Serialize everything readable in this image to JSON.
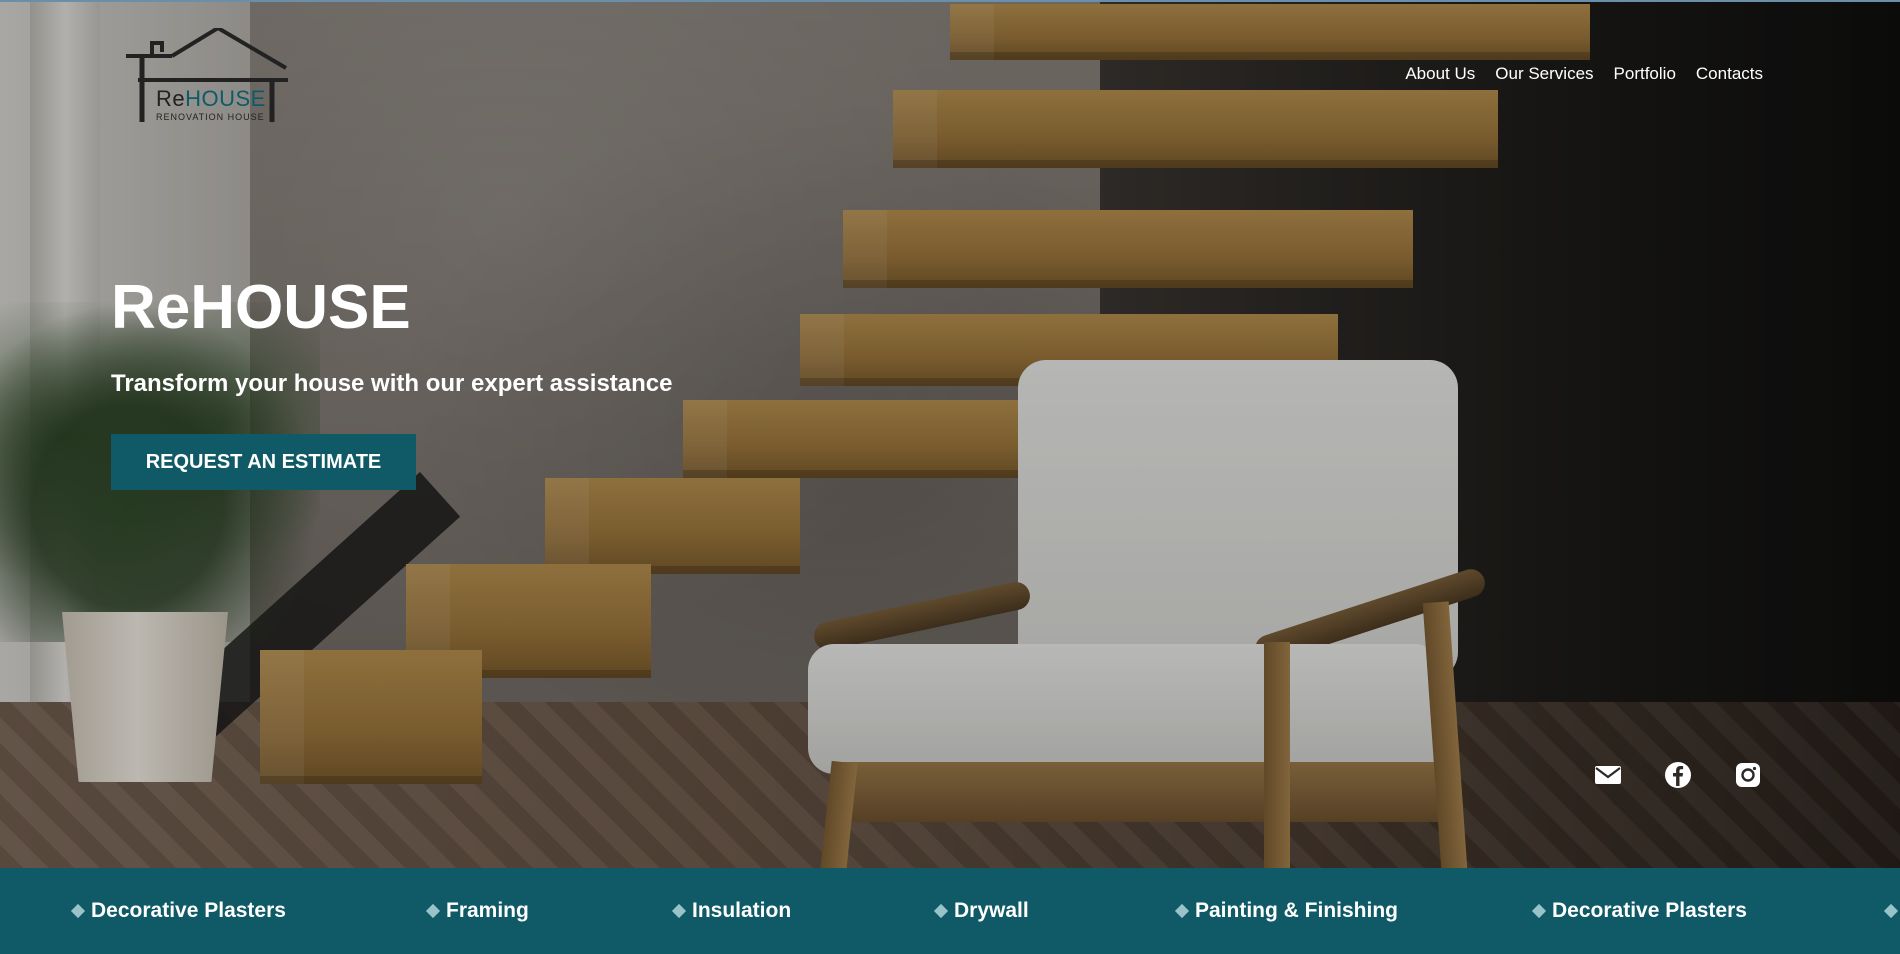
{
  "logo": {
    "word_prefix": "Re",
    "word_highlight": "HOUSE",
    "tagline": "RENOVATION HOUSE"
  },
  "nav": {
    "items": [
      {
        "label": "About Us"
      },
      {
        "label": "Our Services"
      },
      {
        "label": "Portfolio"
      },
      {
        "label": "Contacts"
      }
    ]
  },
  "hero": {
    "title": "ReHOUSE",
    "subtitle": "Transform your house with our expert assistance",
    "cta_label": "REQUEST AN ESTIMATE"
  },
  "social": {
    "icons": [
      "mail-icon",
      "facebook-icon",
      "instagram-icon"
    ]
  },
  "ticker": {
    "items": [
      {
        "label": "Decorative Plasters"
      },
      {
        "label": "Framing"
      },
      {
        "label": "Insulation"
      },
      {
        "label": "Drywall"
      },
      {
        "label": "Painting & Finishing"
      },
      {
        "label": "Decorative Plasters"
      }
    ]
  },
  "colors": {
    "brand": "#0f5a66",
    "text_on_dark": "#ffffff",
    "diamond": "#9ac3c9"
  }
}
